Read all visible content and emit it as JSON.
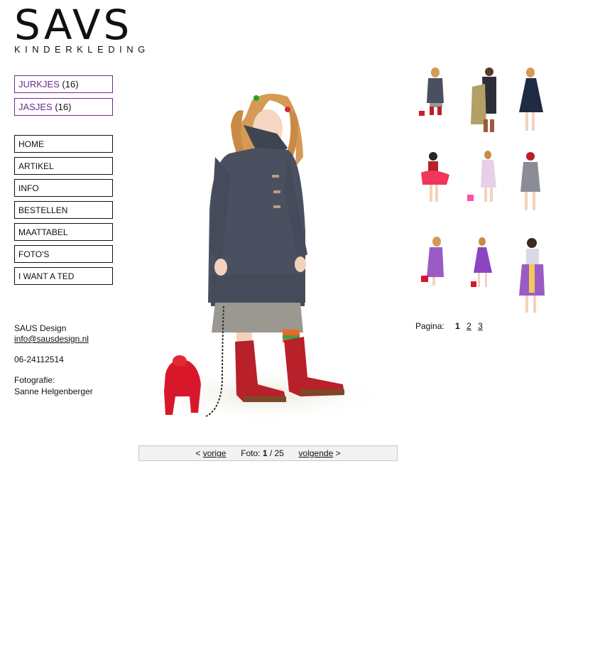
{
  "logo": {
    "main": "SAVS",
    "sub": "KINDERKLEDING"
  },
  "categories": [
    {
      "label": "JURKJES",
      "count": "(16)"
    },
    {
      "label": "JASJES",
      "count": "(16)"
    }
  ],
  "nav": [
    "HOME",
    "ARTIKEL",
    "INFO",
    "BESTELLEN",
    "MAATTABEL",
    "FOTO'S",
    "I WANT A TED"
  ],
  "contact": {
    "company": "SAUS Design",
    "email": "info@sausdesign.nl",
    "phone": "06-24112514",
    "photo_label": "Fotografie:",
    "photographer": "Sanne Helgenberger"
  },
  "pager": {
    "prev_prefix": "<",
    "prev": "vorige",
    "foto_label": "Foto:",
    "current": "1",
    "total": "/ 25",
    "next": "volgende",
    "next_suffix": ">"
  },
  "pagination": {
    "label": "Pagina:",
    "current": "1",
    "pages": [
      "2",
      "3"
    ]
  },
  "colors": {
    "accent": "#6a2c90",
    "coat": "#4a5060",
    "boots": "#b8202a"
  }
}
